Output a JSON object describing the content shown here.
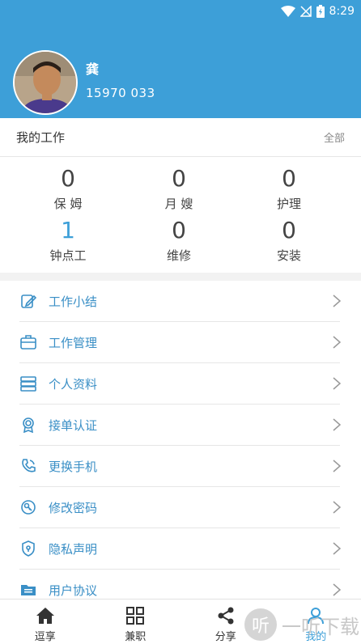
{
  "status_bar": {
    "time": "8:29"
  },
  "profile": {
    "name": "龚",
    "phone": "15970 033"
  },
  "section": {
    "title": "我的工作",
    "all_label": "全部"
  },
  "stats": [
    {
      "value": "0",
      "label": "保 姆",
      "highlight": false
    },
    {
      "value": "0",
      "label": "月 嫂",
      "highlight": false
    },
    {
      "value": "0",
      "label": "护理",
      "highlight": false
    },
    {
      "value": "1",
      "label": "钟点工",
      "highlight": true
    },
    {
      "value": "0",
      "label": "维修",
      "highlight": false
    },
    {
      "value": "0",
      "label": "安装",
      "highlight": false
    }
  ],
  "menu": [
    {
      "label": "工作小结",
      "icon": "edit-note-icon"
    },
    {
      "label": "工作管理",
      "icon": "briefcase-icon"
    },
    {
      "label": "个人资料",
      "icon": "profile-stack-icon"
    },
    {
      "label": "接单认证",
      "icon": "badge-certificate-icon"
    },
    {
      "label": "更换手机",
      "icon": "phone-swap-icon"
    },
    {
      "label": "修改密码",
      "icon": "key-lock-icon"
    },
    {
      "label": "隐私声明",
      "icon": "shield-icon"
    },
    {
      "label": "用户协议",
      "icon": "folder-document-icon"
    }
  ],
  "tabs": [
    {
      "label": "逗享",
      "icon": "home-icon",
      "active": false
    },
    {
      "label": "兼职",
      "icon": "grid-icon",
      "active": false
    },
    {
      "label": "分享",
      "icon": "share-icon",
      "active": false
    },
    {
      "label": "我的",
      "icon": "user-icon",
      "active": true
    }
  ],
  "watermark": {
    "glyph": "听",
    "text": "一听下载"
  },
  "colors": {
    "primary": "#3d9fd8",
    "menu_text": "#3a8fc6",
    "divider": "#e6e6e6"
  }
}
